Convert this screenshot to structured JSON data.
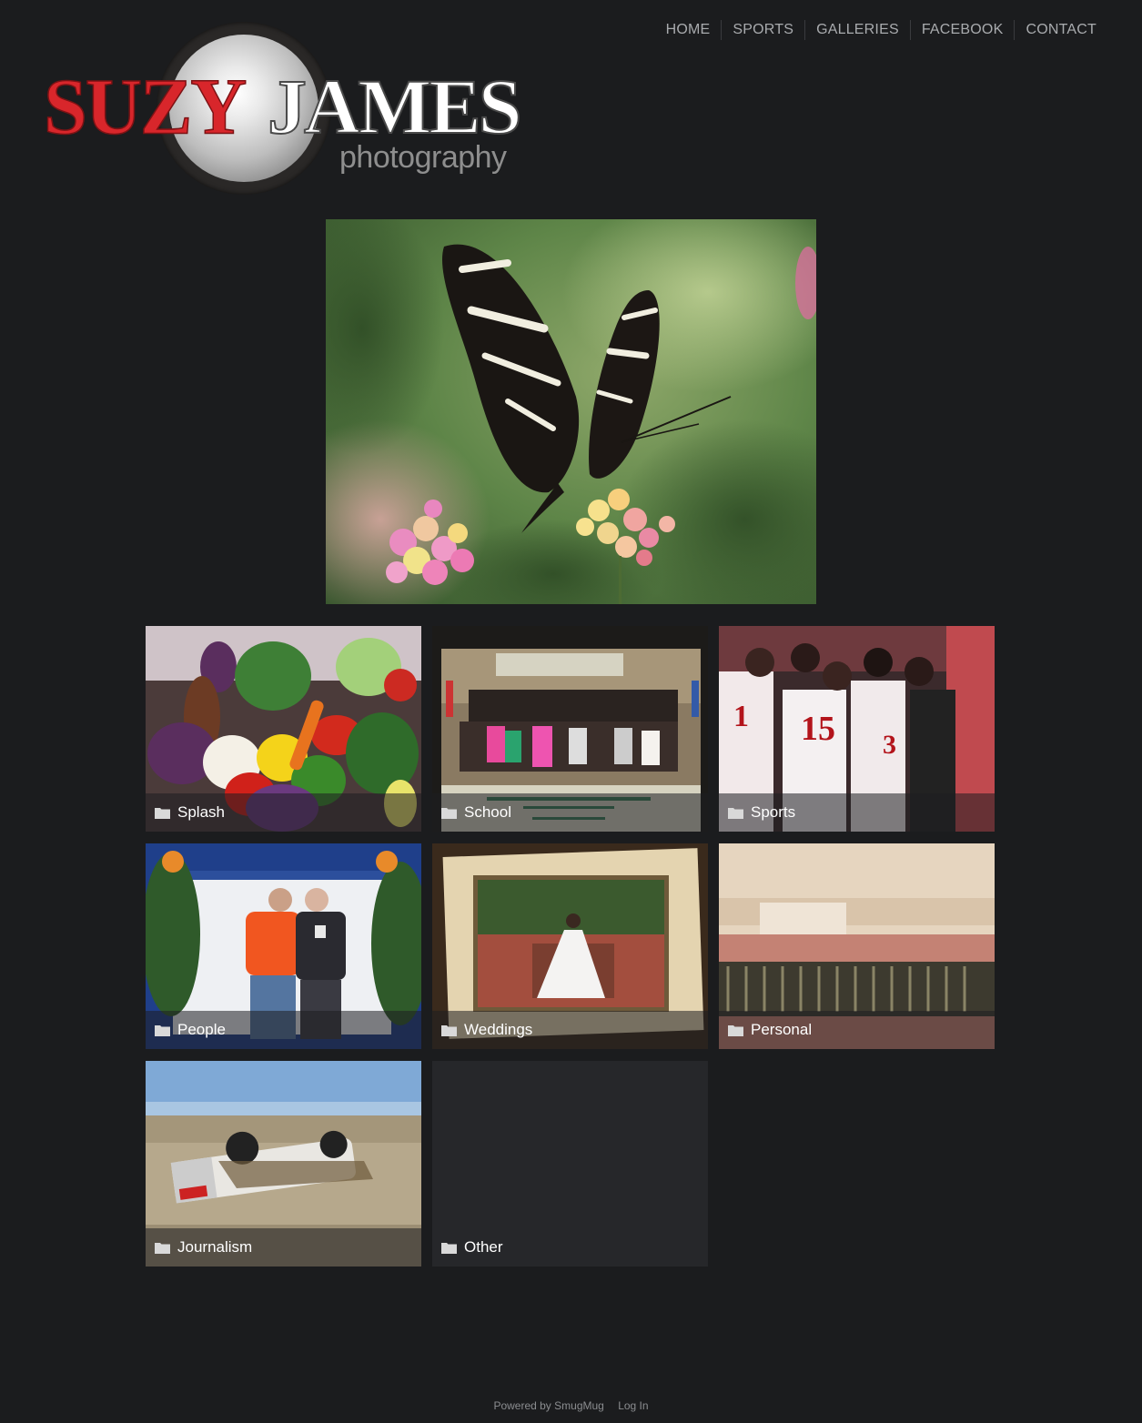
{
  "nav": {
    "items": [
      {
        "label": "HOME"
      },
      {
        "label": "SPORTS"
      },
      {
        "label": "GALLERIES"
      },
      {
        "label": "FACEBOOK"
      },
      {
        "label": "CONTACT"
      }
    ]
  },
  "logo": {
    "word1": "SUZY",
    "word2": "JAMES",
    "word3": "photography"
  },
  "galleries": [
    {
      "label": "Splash",
      "icon": "folder-icon"
    },
    {
      "label": "School",
      "icon": "folder-icon"
    },
    {
      "label": "Sports",
      "icon": "folder-icon"
    },
    {
      "label": "People",
      "icon": "folder-icon"
    },
    {
      "label": "Weddings",
      "icon": "folder-icon"
    },
    {
      "label": "Personal",
      "icon": "folder-icon"
    },
    {
      "label": "Journalism",
      "icon": "folder-icon"
    },
    {
      "label": "Other",
      "icon": "folder-icon"
    }
  ],
  "footer": {
    "powered_by": "Powered by SmugMug",
    "login": "Log In"
  },
  "colors": {
    "background": "#1b1c1e",
    "nav_text": "#a9abae",
    "logo_red": "#d8262b"
  }
}
